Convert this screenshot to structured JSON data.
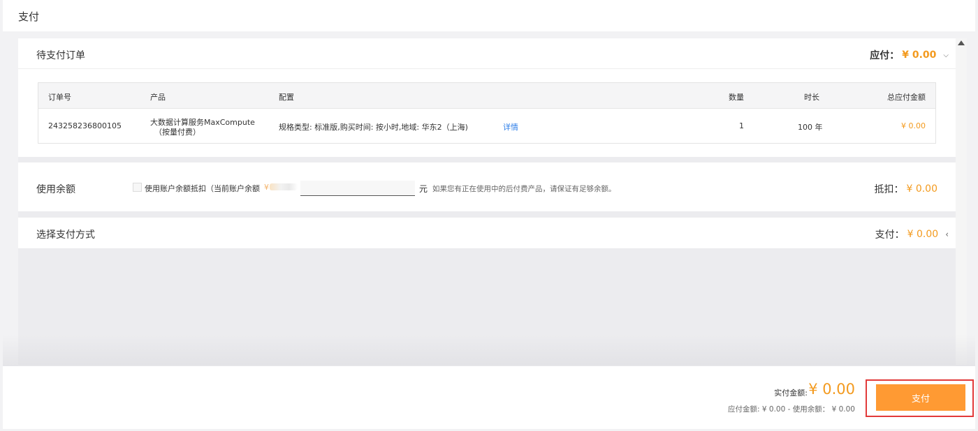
{
  "page": {
    "title": "支付"
  },
  "order_card": {
    "title": "待支付订单",
    "amount_label": "应付：",
    "amount_value": "¥ 0.00",
    "chevron": "chevron-down-icon",
    "table": {
      "headers": [
        "订单号",
        "产品",
        "配置",
        "数量",
        "时长",
        "总应付金额"
      ],
      "rows": [
        {
          "order_no": "243258236800105",
          "product_line1": "大数据计算服务MaxCompute",
          "product_line2": "（按量付费）",
          "config": "规格类型: 标准版,购买时间: 按小时,地域: 华东2（上海)",
          "details_link": "详情",
          "quantity": "1",
          "duration": "100 年",
          "total": "¥ 0.00"
        }
      ]
    }
  },
  "balance_card": {
    "title": "使用余额",
    "checkbox_label": "使用账户余额抵扣（当前账户余额",
    "balance_prefix": "¥",
    "input_value": "",
    "unit": "元",
    "hint": "如果您有正在使用中的后付费产品，请保证有足够余额。",
    "deduct_label": "抵扣：",
    "deduct_value": "¥ 0.00"
  },
  "payment_method_card": {
    "title": "选择支付方式",
    "pay_label": "支付：",
    "pay_value": "¥ 0.00",
    "chevron": "chevron-left-icon"
  },
  "footer": {
    "actual_label": "实付金额:",
    "actual_value": "¥ 0.00",
    "breakdown": "应付金额: ¥ 0.00 - 使用余额： ¥ 0.00",
    "pay_button": "支付"
  },
  "colors": {
    "accent": "#f39a1e",
    "button": "#ff9a33",
    "link": "#2f7fe8",
    "highlight_frame": "#e23a3a"
  }
}
